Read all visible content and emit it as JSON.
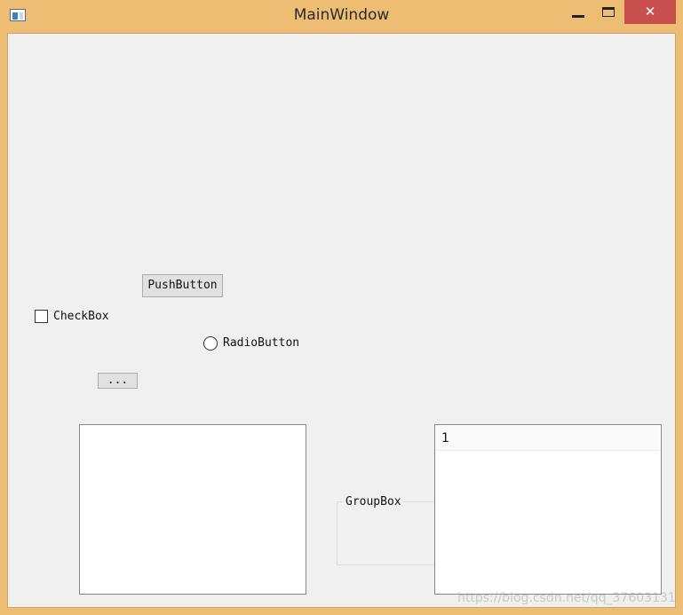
{
  "window": {
    "title": "MainWindow",
    "close_glyph": "✕",
    "frame_color": "#ecbd72",
    "close_color": "#c94f4f"
  },
  "icons": {
    "app": "app-window-icon",
    "minimize": "minimize-icon",
    "maximize": "maximize-icon",
    "close": "close-icon"
  },
  "widgets": {
    "push_button_label": "PushButton",
    "checkbox_label": "CheckBox",
    "checkbox_checked": false,
    "radio_label": "RadioButton",
    "radio_checked": false,
    "tool_button_label": "...",
    "text_area_value": "",
    "group_box_title": "GroupBox",
    "list_items": [
      "1"
    ]
  },
  "watermark": "https://blog.csdn.net/qq_37603131"
}
